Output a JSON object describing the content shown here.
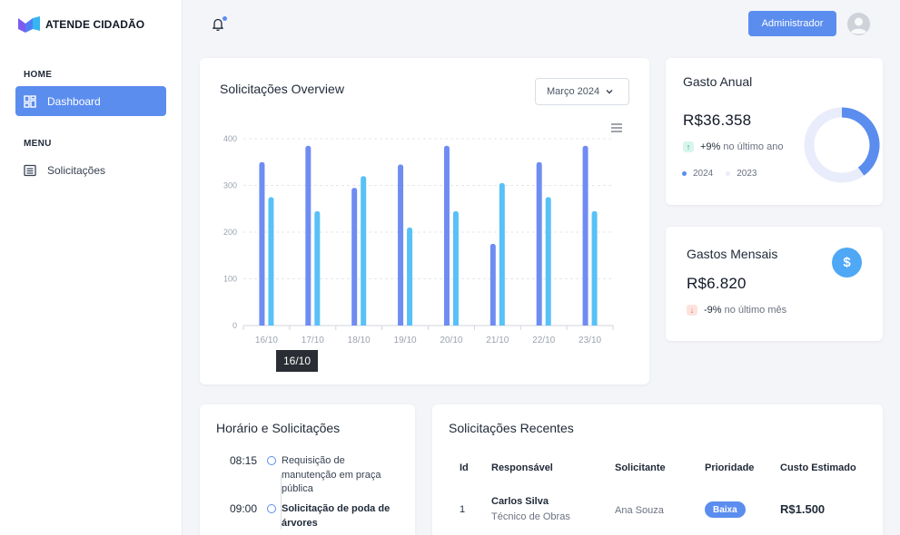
{
  "app": {
    "name": "ATENDE CIDADÃO"
  },
  "sidebar": {
    "sections": [
      {
        "title": "HOME",
        "items": [
          {
            "label": "Dashboard",
            "icon": "dashboard-icon",
            "active": true
          }
        ]
      },
      {
        "title": "MENU",
        "items": [
          {
            "label": "Solicitações",
            "icon": "list-icon",
            "active": false
          }
        ]
      }
    ]
  },
  "topbar": {
    "admin_label": "Administrador"
  },
  "overview": {
    "title": "Solicitações Overview",
    "month_select": "Março 2024",
    "tooltip": "16/10"
  },
  "chart_data": {
    "type": "bar",
    "categories": [
      "16/10",
      "17/10",
      "18/10",
      "19/10",
      "20/10",
      "21/10",
      "22/10",
      "23/10"
    ],
    "series": [
      {
        "values": [
          350,
          385,
          295,
          345,
          385,
          175,
          350,
          385
        ]
      },
      {
        "values": [
          275,
          245,
          320,
          210,
          245,
          305,
          275,
          245
        ]
      }
    ],
    "yticks": [
      "0",
      "100",
      "200",
      "300",
      "400"
    ],
    "ylim": [
      0,
      400
    ],
    "grid": true,
    "colors": [
      "#6f8cf2",
      "#58c1f7"
    ]
  },
  "gasto_anual": {
    "title": "Gasto Anual",
    "amount": "R$36.358",
    "trend_pct": "+9%",
    "trend_text": "no último ano",
    "legend": [
      "2024",
      "2023"
    ],
    "donut_fraction_2024": 0.4,
    "colors": [
      "#5b8def",
      "#e9edfb"
    ]
  },
  "gastos_mensais": {
    "title": "Gastos Mensais",
    "amount": "R$6.820",
    "trend_pct": "-9%",
    "trend_text": "no último mês",
    "icon": "dollar-icon"
  },
  "horario": {
    "title": "Horário e Solicitações",
    "items": [
      {
        "time": "08:15",
        "text": "Requisição de manutenção em praça pública",
        "bold": false
      },
      {
        "time": "09:00",
        "text": "Solicitação de poda de árvores",
        "bold": true
      }
    ]
  },
  "recentes": {
    "title": "Solicitações Recentes",
    "columns": [
      "Id",
      "Responsável",
      "Solicitante",
      "Prioridade",
      "Custo Estimado"
    ],
    "rows": [
      {
        "id": "1",
        "responsavel": "Carlos Silva",
        "cargo": "Técnico de Obras",
        "solicitante": "Ana Souza",
        "prioridade": "Baixa",
        "custo": "R$1.500"
      }
    ]
  }
}
